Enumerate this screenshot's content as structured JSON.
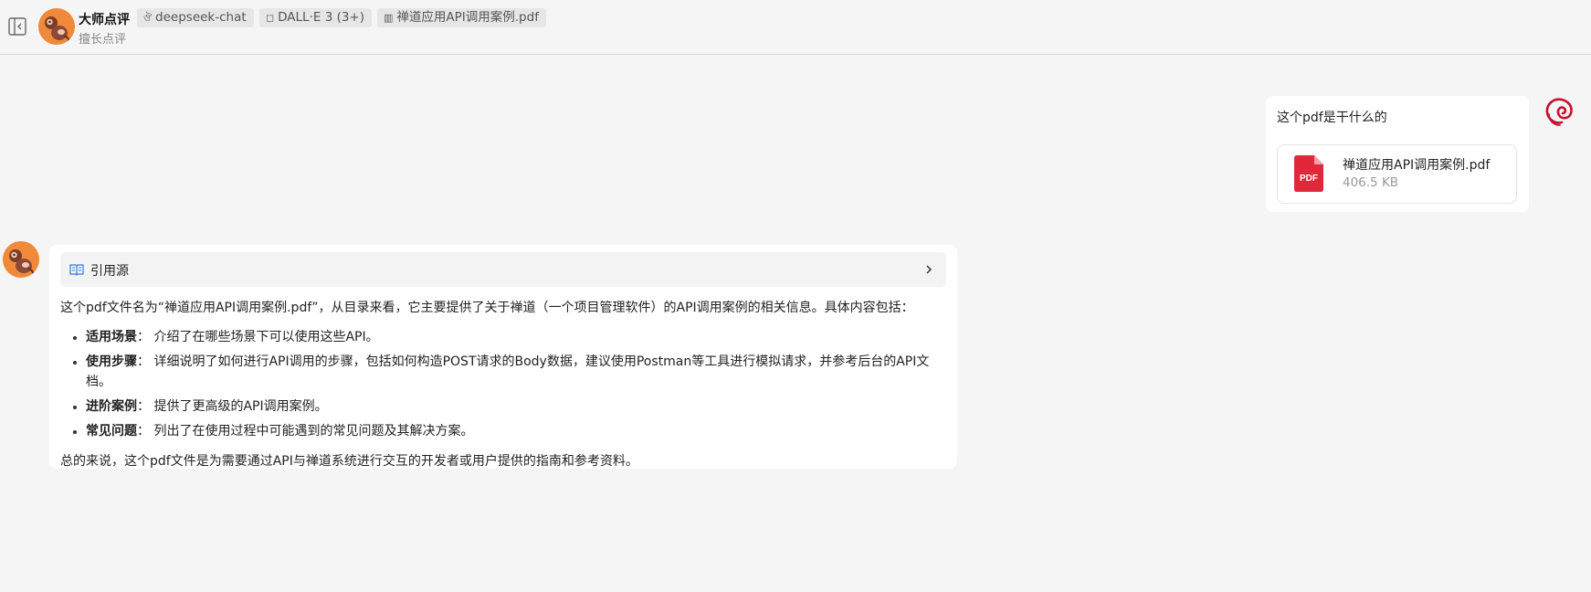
{
  "header": {
    "agent_name": "大师点评",
    "agent_subtitle": "擅长点评",
    "tags": {
      "model": "deepseek-chat",
      "plugin": "DALL·E 3 (3+)",
      "file": "禅道应用API调用案例.pdf"
    }
  },
  "user_message": {
    "text": "这个pdf是干什么的",
    "file": {
      "name": "禅道应用API调用案例.pdf",
      "size": "406.5 KB",
      "type_label": "PDF"
    }
  },
  "assistant_message": {
    "citation_label": "引用源",
    "intro": "这个pdf文件名为“禅道应用API调用案例.pdf”，从目录来看，它主要提供了关于禅道（一个项目管理软件）的API调用案例的相关信息。具体内容包括：",
    "items": [
      {
        "title": "适用场景",
        "sep": "：",
        "text": "介绍了在哪些场景下可以使用这些API。"
      },
      {
        "title": "使用步骤",
        "sep": "：",
        "text": "详细说明了如何进行API调用的步骤，包括如何构造POST请求的Body数据，建议使用Postman等工具进行模拟请求，并参考后台的API文档。"
      },
      {
        "title": "进阶案例",
        "sep": "：",
        "text": "提供了更高级的API调用案例。"
      },
      {
        "title": "常见问题",
        "sep": "：",
        "text": "列出了在使用过程中可能遇到的常见问题及其解决方案。"
      }
    ],
    "conclusion": "总的来说，这个pdf文件是为需要通过API与禅道系统进行交互的开发者或用户提供的指南和参考资料。"
  },
  "colors": {
    "background": "#f5f5f5",
    "bubble": "#ffffff",
    "pdf_red": "#e0283a",
    "user_avatar_red": "#c8102e",
    "agent_avatar_orange": "#f08a3a"
  },
  "icons": {
    "sidebar_toggle": "sidebar-collapse-icon",
    "model_tag": "model-icon",
    "plugin_tag": "plugin-icon",
    "file_tag": "file-icon",
    "citation": "book-icon",
    "chevron": "chevron-right-icon",
    "user_avatar": "debian-swirl-icon",
    "agent_avatar": "monkey-icon"
  }
}
